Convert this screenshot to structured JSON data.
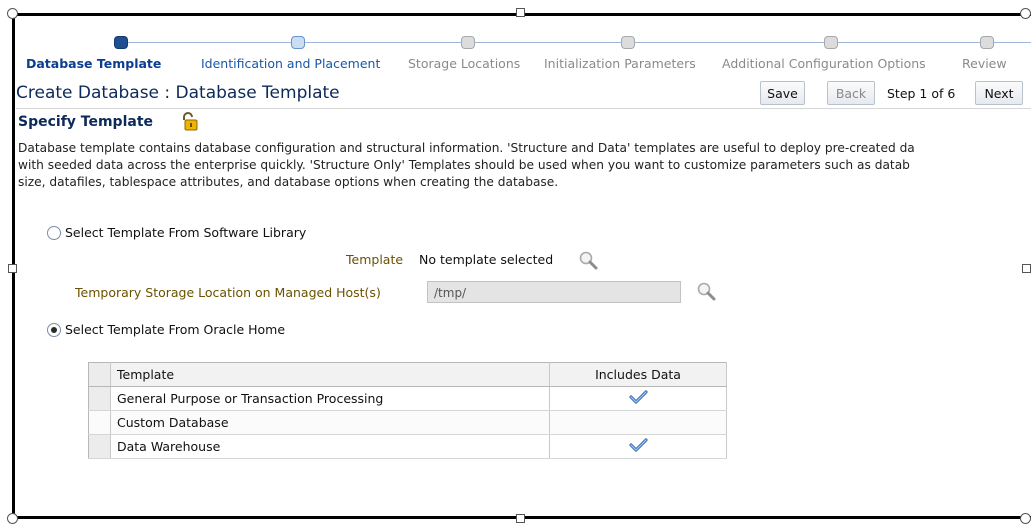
{
  "train": {
    "steps": [
      {
        "label": "Database Template",
        "state": "current"
      },
      {
        "label": "Identification and Placement",
        "state": "link"
      },
      {
        "label": "Storage Locations",
        "state": "disabled"
      },
      {
        "label": "Initialization Parameters",
        "state": "disabled"
      },
      {
        "label": "Additional Configuration Options",
        "state": "disabled"
      },
      {
        "label": "Review",
        "state": "disabled"
      }
    ]
  },
  "header": {
    "title": "Create Database : Database Template",
    "save_label": "Save",
    "back_label": "Back",
    "step_text": "Step 1 of 6",
    "next_label": "Next"
  },
  "section": {
    "title": "Specify Template",
    "description": [
      "Database template contains database configuration and structural information. 'Structure and Data' templates are useful to deploy pre-created da",
      "with seeded data across the enterprise quickly. 'Structure Only' Templates should be used when you want to customize parameters such as datab",
      "size, datafiles, tablespace attributes, and database options when creating the database."
    ]
  },
  "options": {
    "software_library": {
      "label": "Select Template From Software Library",
      "selected": false
    },
    "template_label": "Template",
    "template_value": "No template selected",
    "storage_label": "Temporary Storage Location on Managed Host(s)",
    "storage_value": "/tmp/",
    "oracle_home": {
      "label": "Select Template From Oracle Home",
      "selected": true
    }
  },
  "table": {
    "headers": [
      "Template",
      "Includes Data"
    ],
    "rows": [
      {
        "template": "General Purpose or Transaction Processing",
        "includes_data": true
      },
      {
        "template": "Custom Database",
        "includes_data": false
      },
      {
        "template": "Data Warehouse",
        "includes_data": true
      }
    ]
  },
  "colors": {
    "accent": "#0b3d91",
    "label_gold": "#6b5200"
  },
  "icons": {
    "lock": "lock-open-icon",
    "search": "magnifier-icon",
    "check": "checkmark-icon"
  }
}
